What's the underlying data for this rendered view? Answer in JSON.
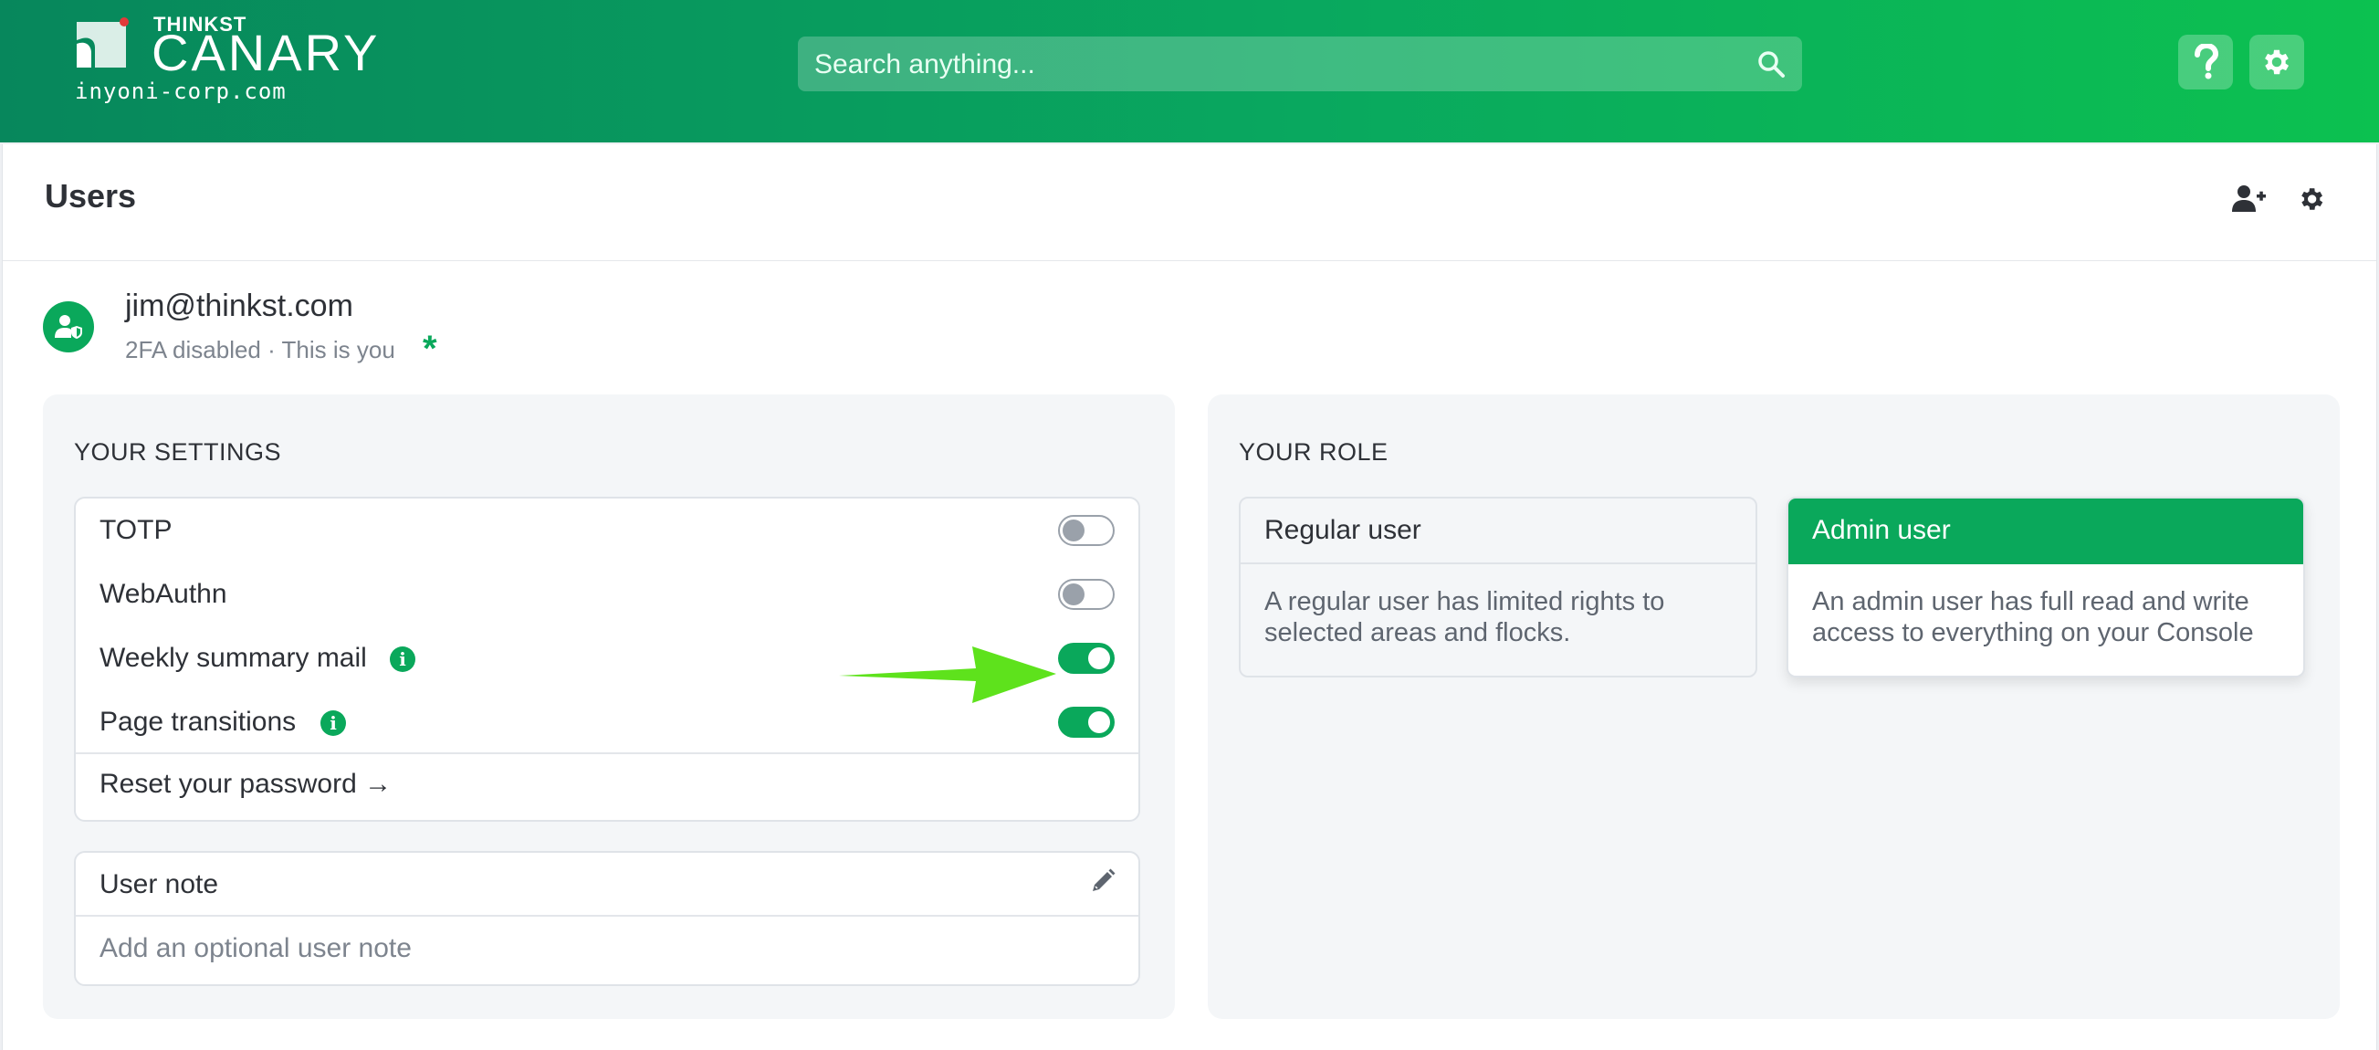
{
  "header": {
    "brand_small": "THINKST",
    "brand_big": "CANARY",
    "domain": "inyoni-corp.com",
    "search_placeholder": "Search anything...",
    "help_icon": "question-icon",
    "settings_icon": "gear-icon"
  },
  "page": {
    "title": "Users",
    "add_user_icon": "add-user-icon",
    "settings_icon": "gear-icon"
  },
  "user": {
    "email": "jim@thinkst.com",
    "status": "2FA disabled · This is you",
    "you_marker": "*"
  },
  "settings": {
    "title": "YOUR SETTINGS",
    "rows": [
      {
        "label": "TOTP",
        "enabled": false,
        "info": false
      },
      {
        "label": "WebAuthn",
        "enabled": false,
        "info": false
      },
      {
        "label": "Weekly summary mail",
        "enabled": true,
        "info": true
      },
      {
        "label": "Page transitions",
        "enabled": true,
        "info": true
      }
    ],
    "reset_link": "Reset your password →",
    "info_glyph": "i"
  },
  "note": {
    "title": "User note",
    "placeholder": "Add an optional user note"
  },
  "role": {
    "title": "YOUR ROLE",
    "options": [
      {
        "name": "Regular user",
        "description": "A regular user has limited rights to selected areas and flocks.",
        "selected": false
      },
      {
        "name": "Admin user",
        "description": "An admin user has full read and write access to everything on your Console",
        "selected": true
      }
    ]
  },
  "colors": {
    "accent": "#0aa85b",
    "header_start": "#07875c",
    "header_end": "#0cc150",
    "annotation_arrow": "#5ee21c"
  }
}
